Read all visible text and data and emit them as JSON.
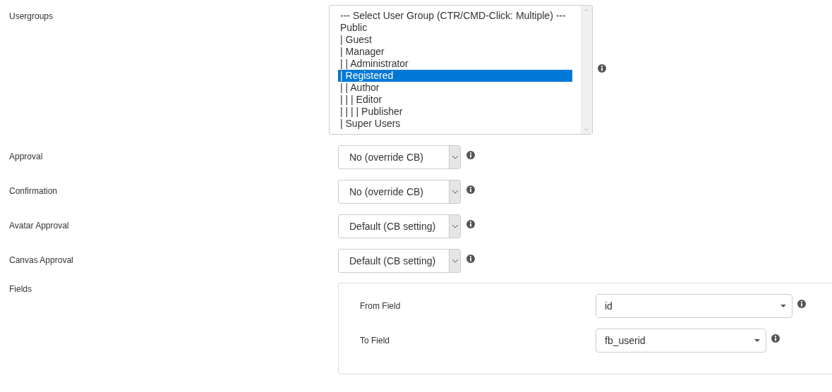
{
  "usergroups": {
    "label": "Usergroups",
    "options": [
      {
        "text": "--- Select User Group (CTR/CMD-Click: Multiple) ---",
        "selected": false
      },
      {
        "text": "Public",
        "selected": false
      },
      {
        "text": "| Guest",
        "selected": false
      },
      {
        "text": "| Manager",
        "selected": false
      },
      {
        "text": "| | Administrator",
        "selected": false
      },
      {
        "text": "| Registered",
        "selected": true
      },
      {
        "text": "| | Author",
        "selected": false
      },
      {
        "text": "| | | Editor",
        "selected": false
      },
      {
        "text": "| | | | Publisher",
        "selected": false
      },
      {
        "text": "| Super Users",
        "selected": false
      }
    ]
  },
  "settings": [
    {
      "label": "Approval",
      "value": "No (override CB)"
    },
    {
      "label": "Confirmation",
      "value": "No (override CB)"
    },
    {
      "label": "Avatar Approval",
      "value": "Default (CB setting)"
    },
    {
      "label": "Canvas Approval",
      "value": "Default (CB setting)"
    }
  ],
  "fields": {
    "label": "Fields",
    "rows": [
      {
        "label": "From Field",
        "value": "id",
        "kind": "wide"
      },
      {
        "label": "To Field",
        "value": "fb_userid",
        "kind": "narrow"
      }
    ]
  }
}
